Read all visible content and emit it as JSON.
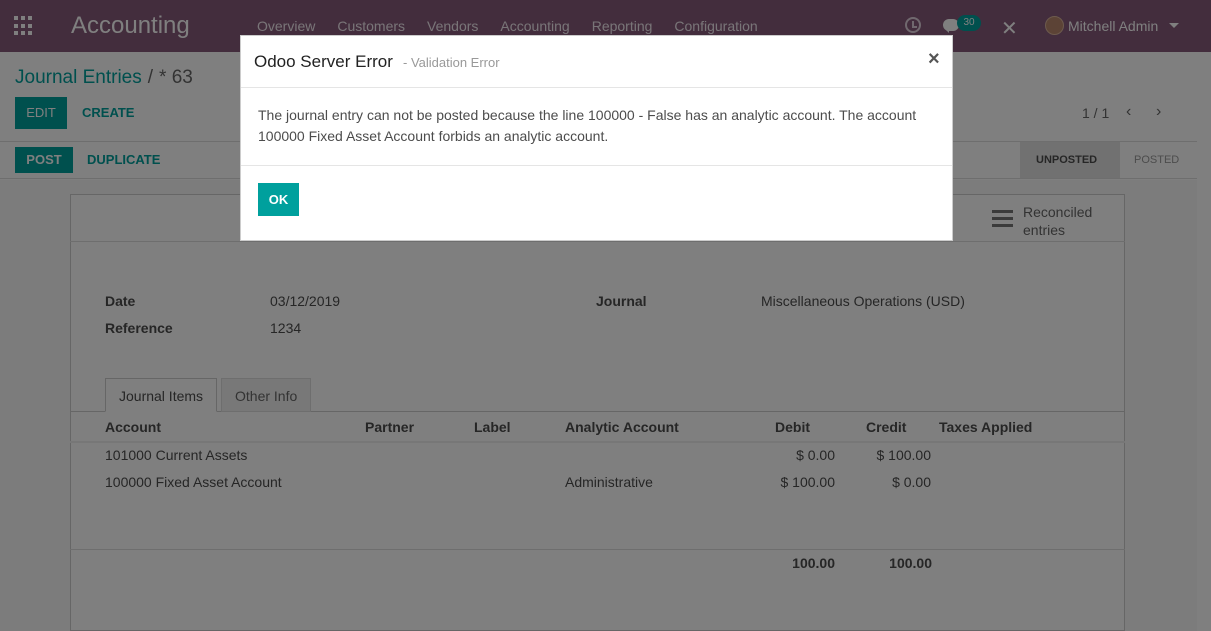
{
  "navbar": {
    "app_title": "Accounting",
    "menu": [
      "Overview",
      "Customers",
      "Vendors",
      "Accounting",
      "Reporting",
      "Configuration"
    ],
    "chat_badge": "30",
    "user_name": "Mitchell Admin",
    "bg_color": "#875a7b"
  },
  "breadcrumb": {
    "parent": "Journal Entries",
    "separator": "/",
    "current": "* 63"
  },
  "control": {
    "edit": "EDIT",
    "create": "CREATE",
    "pager": "1 / 1",
    "post": "POST",
    "duplicate": "DUPLICATE",
    "status_unposted": "UNPOSTED",
    "status_posted": "POSTED",
    "accent_color": "#00a09d"
  },
  "form": {
    "reconciled_label": "Reconciled entries",
    "date_label": "Date",
    "date_value": "03/12/2019",
    "reference_label": "Reference",
    "reference_value": "1234",
    "journal_label": "Journal",
    "journal_value": "Miscellaneous Operations (USD)",
    "tabs": [
      "Journal Items",
      "Other Info"
    ],
    "columns": [
      "Account",
      "Partner",
      "Label",
      "Analytic Account",
      "Debit",
      "Credit",
      "Taxes Applied"
    ],
    "rows": [
      {
        "account": "101000 Current Assets",
        "partner": "",
        "label": "",
        "analytic": "",
        "debit": "$ 0.00",
        "credit": "$ 100.00",
        "taxes": ""
      },
      {
        "account": "100000 Fixed Asset Account",
        "partner": "",
        "label": "",
        "analytic": "Administrative",
        "debit": "$ 100.00",
        "credit": "$ 0.00",
        "taxes": ""
      }
    ],
    "total_debit": "100.00",
    "total_credit": "100.00"
  },
  "dialog": {
    "title": "Odoo Server Error",
    "subtitle": "- Validation Error",
    "close": "×",
    "message": "The journal entry can not be posted because the line 100000 - False has an analytic account. The account 100000 Fixed Asset Account forbids an analytic account.",
    "ok": "OK"
  }
}
